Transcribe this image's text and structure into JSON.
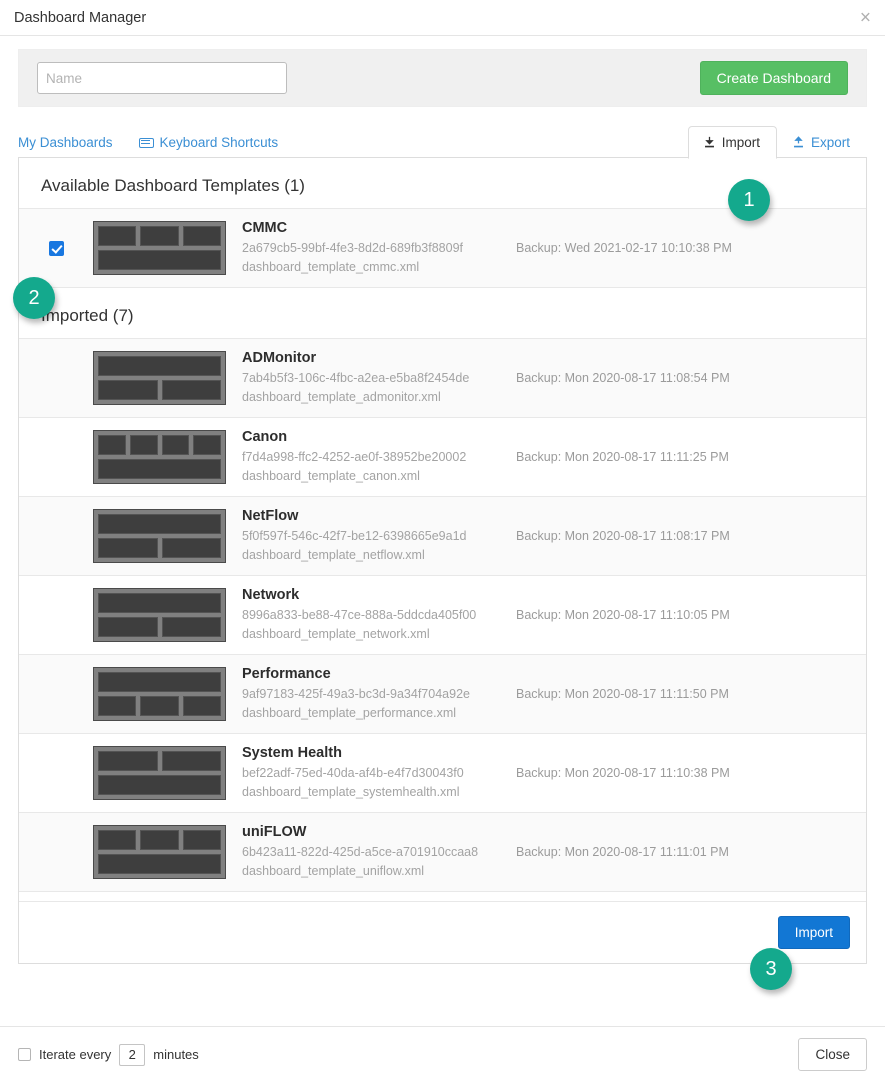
{
  "window": {
    "title": "Dashboard Manager",
    "close_icon": "close-icon",
    "close_glyph": "×"
  },
  "create_bar": {
    "name_placeholder": "Name",
    "name_value": "",
    "create_label": "Create Dashboard"
  },
  "tabs": {
    "left": [
      {
        "label": "My Dashboards",
        "icon": null
      },
      {
        "label": "Keyboard Shortcuts",
        "icon": "keyboard-icon"
      }
    ],
    "right": [
      {
        "label": "Import",
        "icon": "import-download-icon",
        "active": true
      },
      {
        "label": "Export",
        "icon": "export-upload-icon",
        "active": false
      }
    ]
  },
  "available_section": {
    "title": "Available Dashboard Templates (1)",
    "items": [
      {
        "name": "CMMC",
        "uuid": "2a679cb5-99bf-4fe3-8d2d-689fb3f8809f",
        "file": "dashboard_template_cmmc.xml",
        "backup": "Backup: Wed 2021-02-17 10:10:38 PM",
        "checked": true,
        "layout": [
          3,
          1
        ]
      }
    ]
  },
  "imported_section": {
    "title": "Imported (7)",
    "items": [
      {
        "name": "ADMonitor",
        "uuid": "7ab4b5f3-106c-4fbc-a2ea-e5ba8f2454de",
        "file": "dashboard_template_admonitor.xml",
        "backup": "Backup: Mon 2020-08-17 11:08:54 PM",
        "layout": [
          1,
          2
        ]
      },
      {
        "name": "Canon",
        "uuid": "f7d4a998-ffc2-4252-ae0f-38952be20002",
        "file": "dashboard_template_canon.xml",
        "backup": "Backup: Mon 2020-08-17 11:11:25 PM",
        "layout": [
          4,
          1
        ]
      },
      {
        "name": "NetFlow",
        "uuid": "5f0f597f-546c-42f7-be12-6398665e9a1d",
        "file": "dashboard_template_netflow.xml",
        "backup": "Backup: Mon 2020-08-17 11:08:17 PM",
        "layout": [
          1,
          2
        ]
      },
      {
        "name": "Network",
        "uuid": "8996a833-be88-47ce-888a-5ddcda405f00",
        "file": "dashboard_template_network.xml",
        "backup": "Backup: Mon 2020-08-17 11:10:05 PM",
        "layout": [
          1,
          2
        ]
      },
      {
        "name": "Performance",
        "uuid": "9af97183-425f-49a3-bc3d-9a34f704a92e",
        "file": "dashboard_template_performance.xml",
        "backup": "Backup: Mon 2020-08-17 11:11:50 PM",
        "layout": [
          1,
          3
        ]
      },
      {
        "name": "System Health",
        "uuid": "bef22adf-75ed-40da-af4b-e4f7d30043f0",
        "file": "dashboard_template_systemhealth.xml",
        "backup": "Backup: Mon 2020-08-17 11:10:38 PM",
        "layout": [
          2,
          1
        ]
      },
      {
        "name": "uniFLOW",
        "uuid": "6b423a11-822d-425d-a5ce-a701910ccaa8",
        "file": "dashboard_template_uniflow.xml",
        "backup": "Backup: Mon 2020-08-17 11:11:01 PM",
        "layout": [
          3,
          1
        ]
      }
    ]
  },
  "panel_footer": {
    "import_label": "Import"
  },
  "modal_footer": {
    "iterate_prefix": "Iterate every",
    "iterate_value": "2",
    "iterate_suffix": "minutes",
    "iterate_checked": false,
    "close_label": "Close"
  },
  "step_badges": [
    {
      "number": "1"
    },
    {
      "number": "2"
    },
    {
      "number": "3"
    }
  ],
  "colors": {
    "badge_teal": "#14a98d",
    "create_green": "#57bf64",
    "import_blue": "#1277d4",
    "link_blue": "#3b8fd4",
    "checkbox_blue": "#1877e0"
  }
}
